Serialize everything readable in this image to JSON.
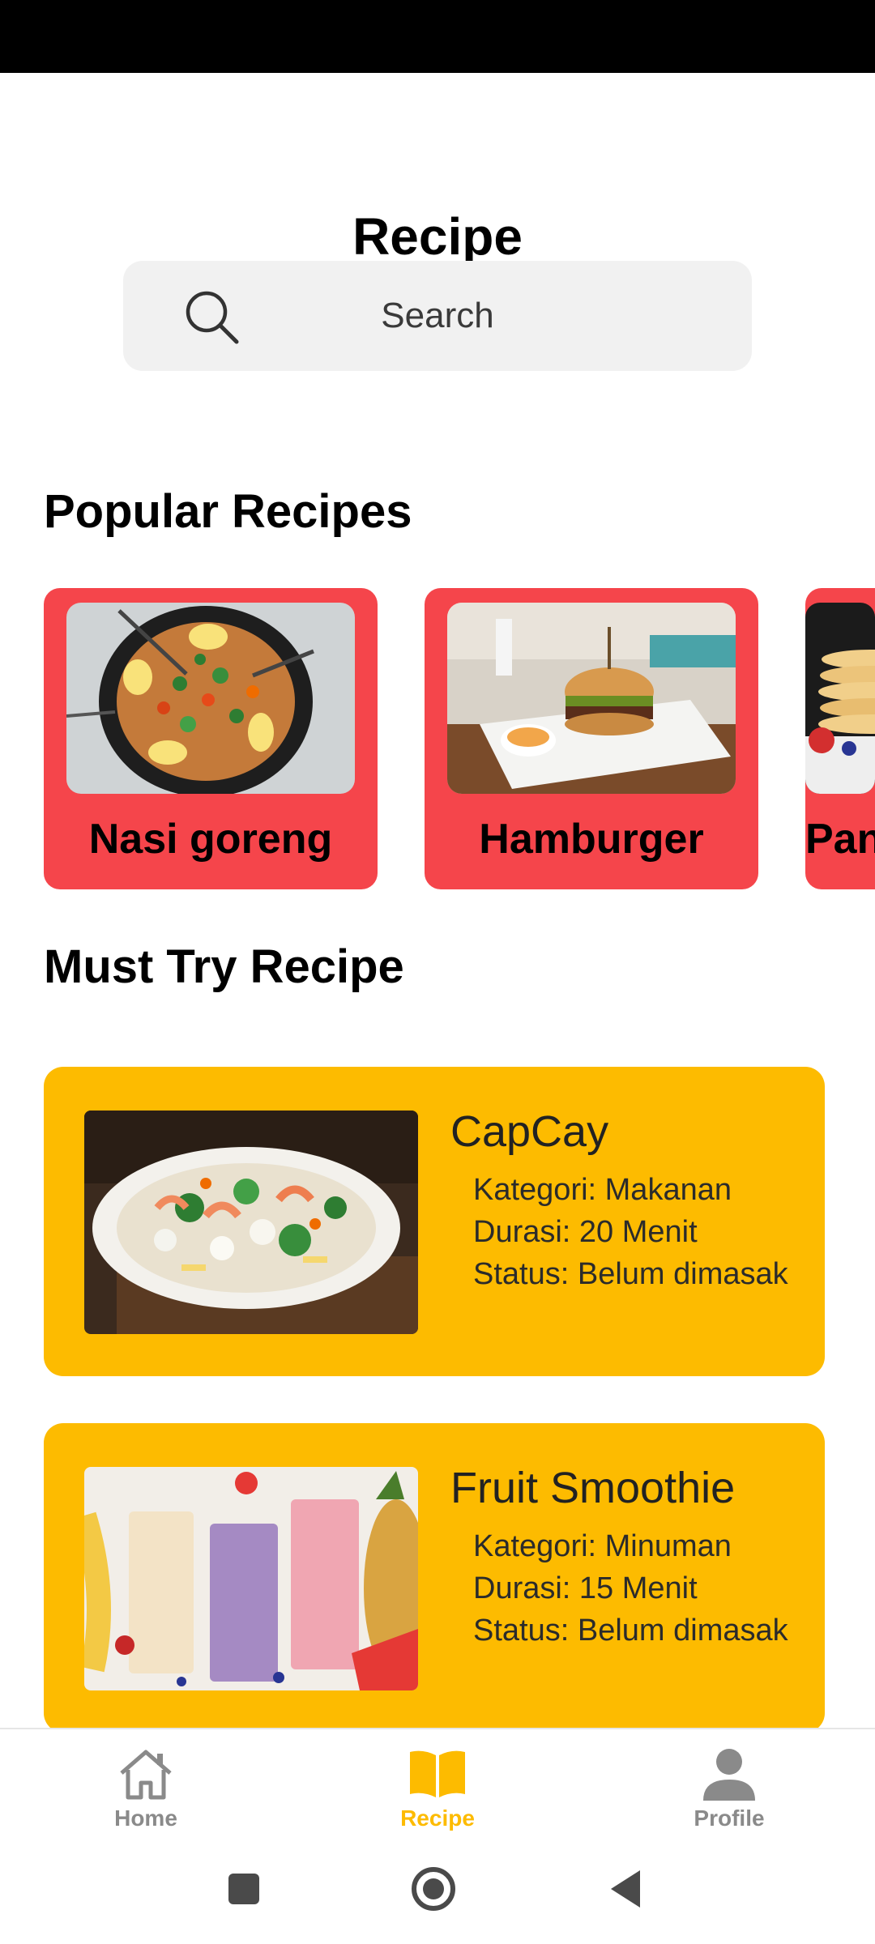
{
  "header": {
    "title": "Recipe"
  },
  "search": {
    "placeholder": "Search"
  },
  "popular": {
    "title": "Popular Recipes",
    "items": [
      {
        "label": "Nasi goreng"
      },
      {
        "label": "Hamburger"
      },
      {
        "label": "Pan"
      }
    ]
  },
  "must_try": {
    "title": "Must Try Recipe",
    "items": [
      {
        "name": "CapCay",
        "category": "Kategori: Makanan",
        "duration": "Durasi: 20 Menit",
        "status": "Status: Belum dimasak"
      },
      {
        "name": "Fruit Smoothie",
        "category": "Kategori: Minuman",
        "duration": "Durasi: 15 Menit",
        "status": "Status: Belum dimasak"
      }
    ]
  },
  "bottom_nav": {
    "items": [
      {
        "label": "Home",
        "icon": "home-icon",
        "active": false
      },
      {
        "label": "Recipe",
        "icon": "book-icon",
        "active": true
      },
      {
        "label": "Profile",
        "icon": "person-icon",
        "active": false
      }
    ]
  },
  "colors": {
    "popular_card": "#f5454b",
    "must_card": "#fdbb00",
    "nav_active": "#fdbb00",
    "nav_inactive": "#8a8a8a"
  }
}
